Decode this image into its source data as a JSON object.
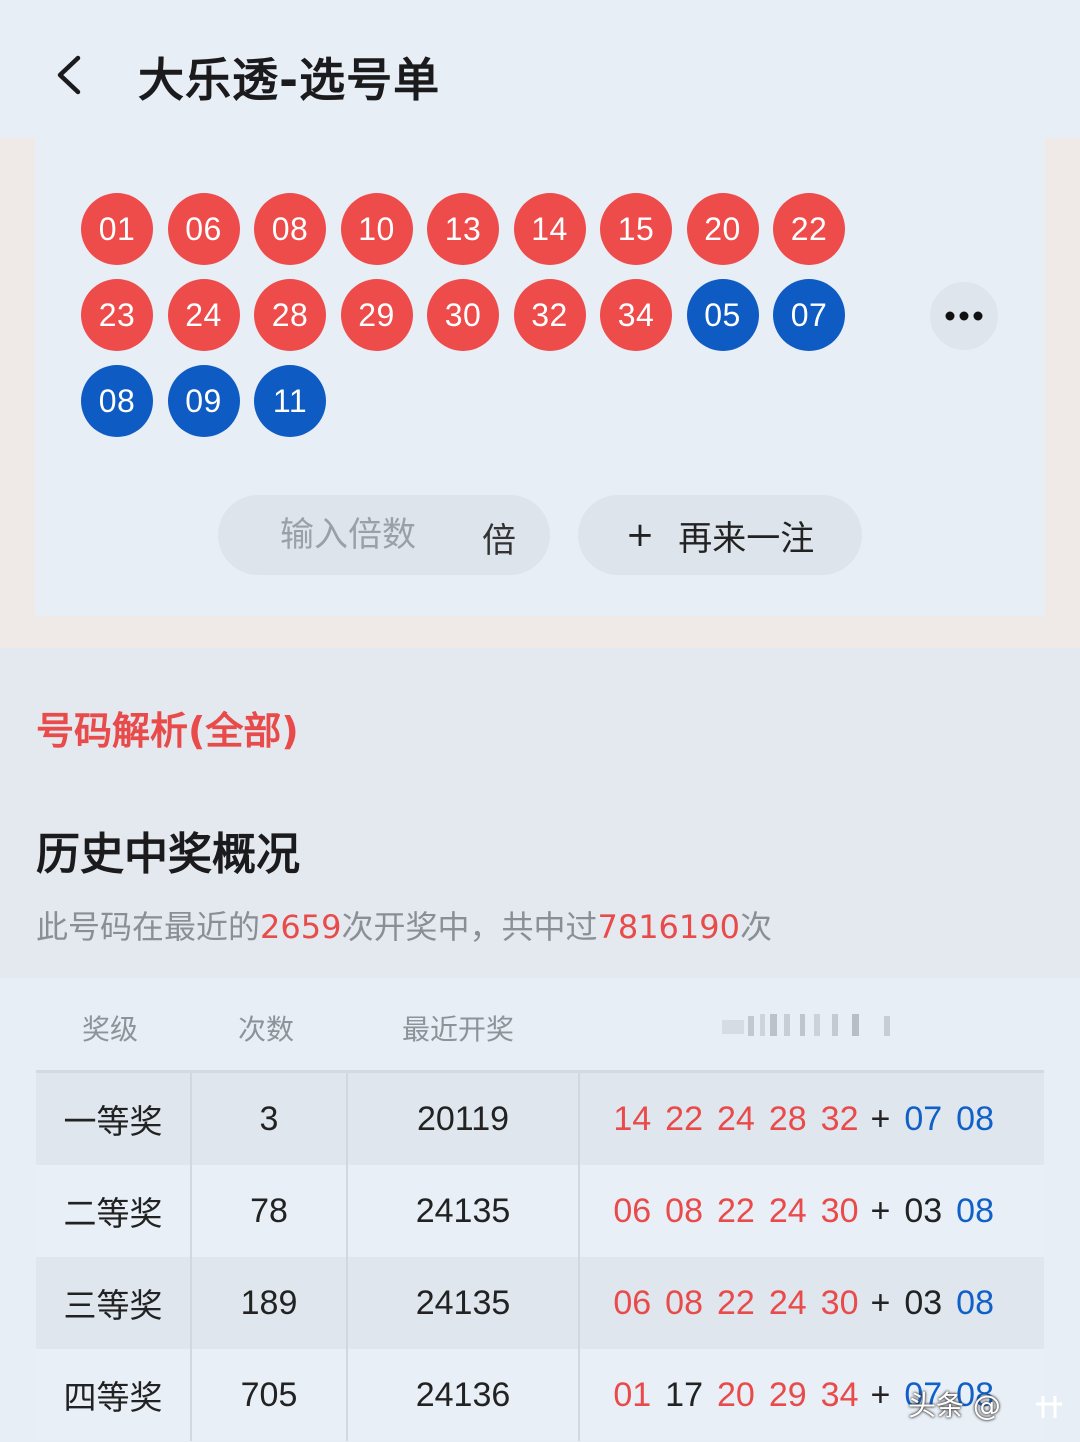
{
  "header": {
    "title": "大乐透-选号单"
  },
  "ticket": {
    "red_balls": [
      "01",
      "06",
      "08",
      "10",
      "13",
      "14",
      "15",
      "20",
      "22",
      "23",
      "24",
      "28",
      "29",
      "30",
      "32",
      "34"
    ],
    "blue_balls": [
      "05",
      "07",
      "08",
      "09",
      "11"
    ],
    "multiplier_placeholder": "输入倍数",
    "multiplier_unit": "倍",
    "add_plus": "+",
    "add_label": "再来一注"
  },
  "analysis": {
    "link": "号码解析(全部)",
    "history_title": "历史中奖概况",
    "summary_prefix": "此号码在最近的",
    "draw_count": "2659",
    "summary_middle": "次开奖中，共中过",
    "win_count": "7816190",
    "summary_suffix": "次"
  },
  "table": {
    "headers": {
      "level": "奖级",
      "count": "次数",
      "latest": "最近开奖"
    },
    "rows": [
      {
        "level": "一等奖",
        "count": "3",
        "latest": "20119",
        "front": [
          {
            "n": "14",
            "c": "red"
          },
          {
            "n": "22",
            "c": "red"
          },
          {
            "n": "24",
            "c": "red"
          },
          {
            "n": "28",
            "c": "red"
          },
          {
            "n": "32",
            "c": "red"
          }
        ],
        "back": [
          {
            "n": "07",
            "c": "blue"
          },
          {
            "n": "08",
            "c": "blue"
          }
        ]
      },
      {
        "level": "二等奖",
        "count": "78",
        "latest": "24135",
        "front": [
          {
            "n": "06",
            "c": "red"
          },
          {
            "n": "08",
            "c": "red"
          },
          {
            "n": "22",
            "c": "red"
          },
          {
            "n": "24",
            "c": "red"
          },
          {
            "n": "30",
            "c": "red"
          }
        ],
        "back": [
          {
            "n": "03",
            "c": "black"
          },
          {
            "n": "08",
            "c": "blue"
          }
        ]
      },
      {
        "level": "三等奖",
        "count": "189",
        "latest": "24135",
        "front": [
          {
            "n": "06",
            "c": "red"
          },
          {
            "n": "08",
            "c": "red"
          },
          {
            "n": "22",
            "c": "red"
          },
          {
            "n": "24",
            "c": "red"
          },
          {
            "n": "30",
            "c": "red"
          }
        ],
        "back": [
          {
            "n": "03",
            "c": "black"
          },
          {
            "n": "08",
            "c": "blue"
          }
        ]
      },
      {
        "level": "四等奖",
        "count": "705",
        "latest": "24136",
        "front": [
          {
            "n": "01",
            "c": "red"
          },
          {
            "n": "17",
            "c": "black"
          },
          {
            "n": "20",
            "c": "red"
          },
          {
            "n": "29",
            "c": "red"
          },
          {
            "n": "34",
            "c": "red"
          }
        ],
        "back": [
          {
            "n": "07",
            "c": "blue"
          },
          {
            "n": "08",
            "c": "blue"
          }
        ]
      }
    ],
    "plus": "+"
  },
  "watermark": "头条 @",
  "colors": {
    "red": "#ee4b4b",
    "blue": "#0e5bc4",
    "accent": "#e94a4a"
  }
}
